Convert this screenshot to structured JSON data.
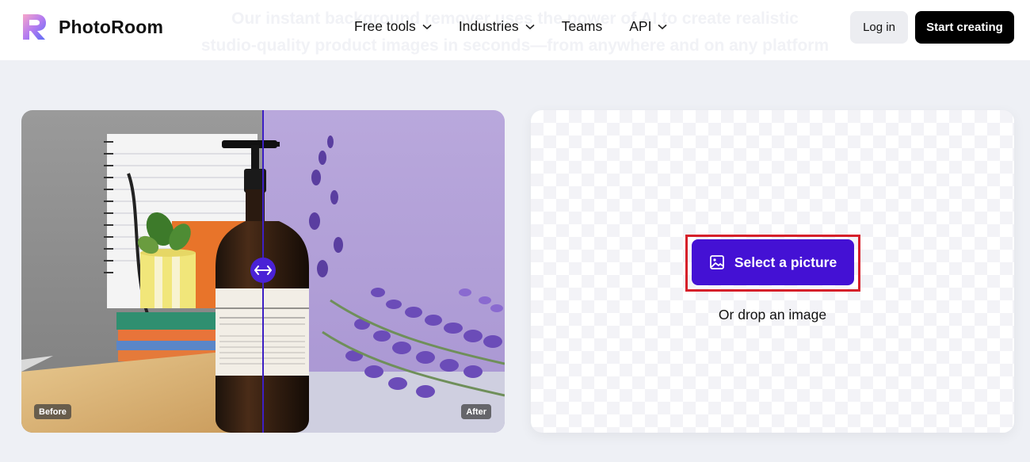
{
  "nav": {
    "brand": "PhotoRoom",
    "ghost_line1": "Our instant background remover uses the power of AI to create realistic",
    "ghost_line2": "studio-quality product images in seconds—from anywhere and on any platform",
    "menu": [
      {
        "label": "Free tools",
        "has_dropdown": true
      },
      {
        "label": "Industries",
        "has_dropdown": true
      },
      {
        "label": "Teams",
        "has_dropdown": false
      },
      {
        "label": "API",
        "has_dropdown": true
      }
    ],
    "login": "Log in",
    "start": "Start creating"
  },
  "compare": {
    "before_label": "Before",
    "after_label": "After",
    "product_brand": "Æsop.",
    "product_name": "Resurrection Aromatique Hand Wash",
    "accent_color": "#4a22d6"
  },
  "upload": {
    "select_label": "Select a picture",
    "drop_label": "Or drop an image",
    "button_color": "#4411d4",
    "highlight_color": "#d6202a"
  }
}
